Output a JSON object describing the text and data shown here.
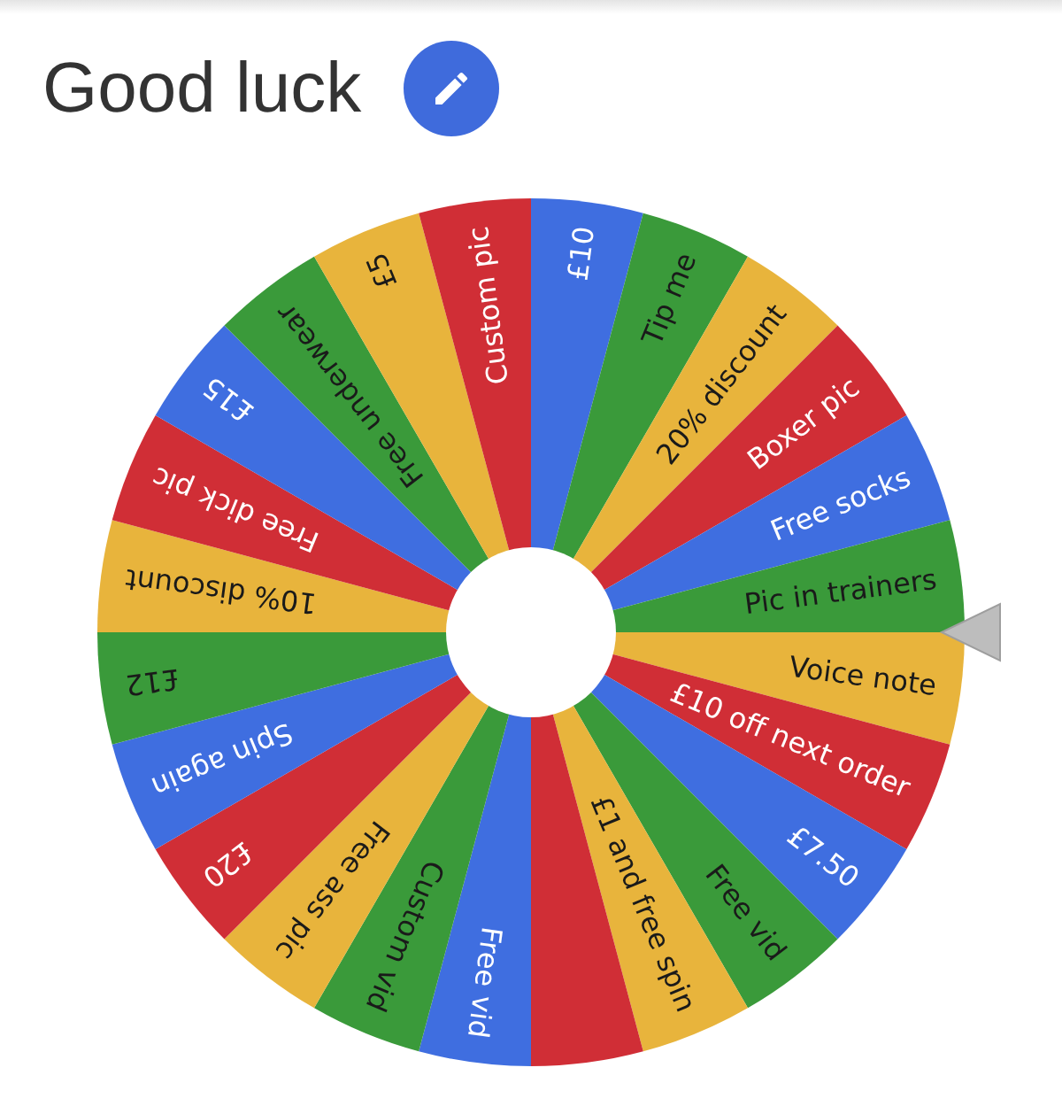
{
  "title": "Good luck",
  "wheel": {
    "segments": [
      {
        "label": "£10",
        "color": "#3f6ee0"
      },
      {
        "label": "Tip me",
        "color": "#3a9a3a"
      },
      {
        "label": "20% discount",
        "color": "#e8b43c"
      },
      {
        "label": "Boxer pic",
        "color": "#d02e36"
      },
      {
        "label": "Free socks",
        "color": "#3f6ee0"
      },
      {
        "label": "Pic in trainers",
        "color": "#3a9a3a"
      },
      {
        "label": "Voice note",
        "color": "#e8b43c"
      },
      {
        "label": "£10 off next order",
        "color": "#d02e36"
      },
      {
        "label": "£7.50",
        "color": "#3f6ee0"
      },
      {
        "label": "Free vid",
        "color": "#3a9a3a"
      },
      {
        "label": "£1 and free spin",
        "color": "#e8b43c"
      },
      {
        "color": "#d02e36"
      },
      {
        "label": "Free vid",
        "color": "#3f6ee0"
      },
      {
        "label": "Custom vid",
        "color": "#3a9a3a"
      },
      {
        "label": "Free ass pic",
        "color": "#e8b43c"
      },
      {
        "label": "£20",
        "color": "#d02e36"
      },
      {
        "label": "Spin again",
        "color": "#3f6ee0"
      },
      {
        "label": "£12",
        "color": "#3a9a3a"
      },
      {
        "label": "10% discount",
        "color": "#e8b43c"
      },
      {
        "label": "Free dick pic",
        "color": "#d02e36"
      },
      {
        "label": "£15",
        "color": "#3f6ee0"
      },
      {
        "label": "Free underwear",
        "color": "#3a9a3a"
      },
      {
        "label": "£5",
        "color": "#e8b43c"
      },
      {
        "label": "Custom pic",
        "color": "#d02e36"
      }
    ]
  }
}
